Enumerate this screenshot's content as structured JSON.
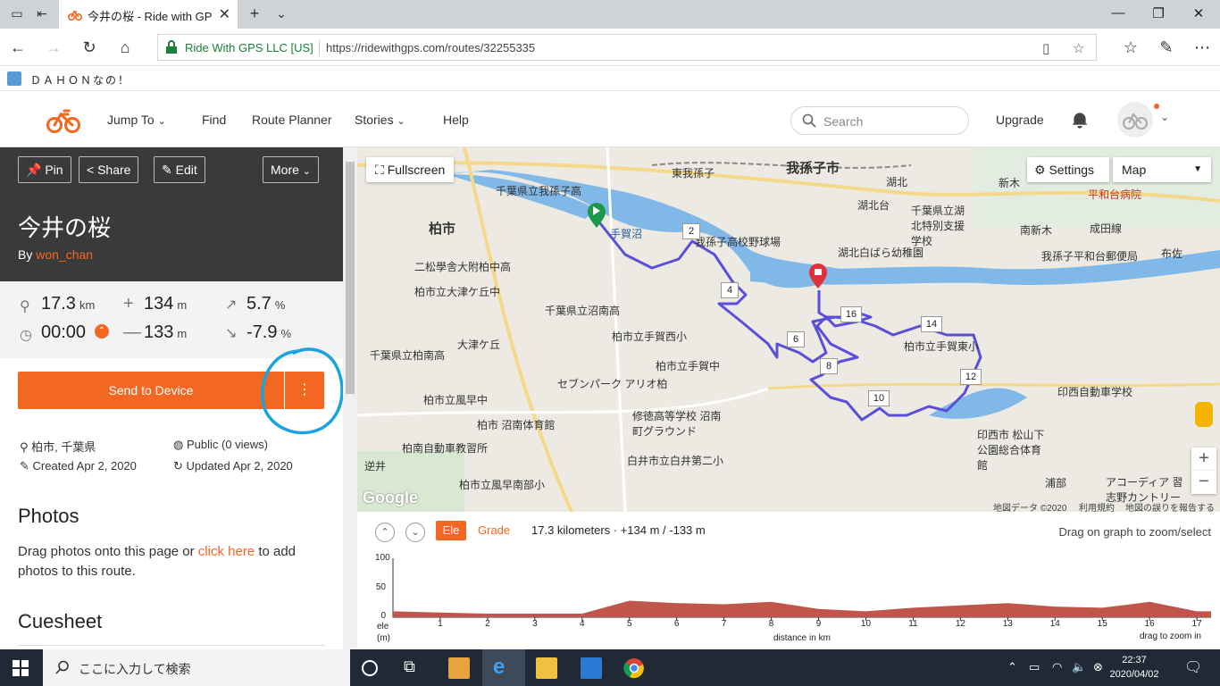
{
  "browser": {
    "tab_title": "今井の桜 - Ride with GPS",
    "cert": "Ride With GPS LLC [US]",
    "url": "https://ridewithgps.com/routes/32255335",
    "favorite": "ＤＡＨＯＮなの！"
  },
  "header": {
    "nav": [
      "Jump To",
      "Find",
      "Route Planner",
      "Stories",
      "Help"
    ],
    "search_placeholder": "Search",
    "upgrade": "Upgrade"
  },
  "route": {
    "buttons": {
      "pin": "Pin",
      "share": "Share",
      "edit": "Edit",
      "more": "More"
    },
    "title": "今井の桜",
    "by_label": "By",
    "owner": "won_chan",
    "stats": {
      "distance": "17.3",
      "distance_unit": "km",
      "gain": "134",
      "gain_unit": "m",
      "grade_up": "5.7",
      "grade_up_unit": "%",
      "time": "00:00",
      "loss": "133",
      "loss_unit": "m",
      "grade_down": "-7.9",
      "grade_down_unit": "%"
    },
    "send_button": "Send to Device",
    "location": "柏市, 千葉県",
    "privacy": "Public (0 views)",
    "created": "Created Apr 2, 2020",
    "updated": "Updated Apr 2, 2020",
    "photos_heading": "Photos",
    "photos_text_a": "Drag photos onto this page or ",
    "photos_link": "click here",
    "photos_text_b": " to add photos to this route.",
    "cuesheet_heading": "Cuesheet"
  },
  "map": {
    "fullscreen": "Fullscreen",
    "settings": "Settings",
    "map_type": "Map",
    "labels": {
      "abiko": "我孫子市",
      "kashiwa": "柏市",
      "tega": "手賀沼",
      "l1": "千葉県立我孫子高",
      "l2": "我孫子高校野球場",
      "l3": "湖北白ばら幼稚園",
      "l4": "千葉県立湖北特別支援学校",
      "l5": "我孫子平和台郵便局",
      "l6": "二松學舎大附柏中高",
      "l7": "柏市立大津ケ丘中",
      "l8": "千葉県立沼南高",
      "l9": "柏市立手賀西小",
      "l10": "千葉県立柏南高",
      "l11": "大津ケ丘",
      "l12": "柏市立手賀中",
      "l13": "セブンパーク アリオ柏",
      "l14": "柏市立風早中",
      "l15": "柏市 沼南体育館",
      "l16": "修徳高等学校 沼南町グラウンド",
      "l17": "柏南自動車教習所",
      "l18": "白井市立白井第二小",
      "l19": "柏市立風早南部小",
      "l20": "柏市立手賀東小",
      "l21": "印西自動車学校",
      "l22": "印西市 松山下 公園総合体育館",
      "l23": "平和台病院",
      "l24": "湖北台",
      "l25": "布佐",
      "l26": "新木",
      "l27": "南新木",
      "l28": "成田線",
      "l29": "浦部",
      "l30": "逆井",
      "l31": "湖北",
      "l32": "東我孫子",
      "l33": "アコーディア 習志野カントリー"
    },
    "markers": [
      "2",
      "4",
      "6",
      "8",
      "10",
      "12",
      "14",
      "16"
    ],
    "attrib_data": "地図データ ©2020",
    "attrib_terms": "利用規約",
    "attrib_report": "地図の誤りを報告する",
    "google": "Google"
  },
  "elevation": {
    "ele_tab": "Ele",
    "grade_tab": "Grade",
    "summary": "17.3 kilometers · +134 m / -133 m",
    "hint": "Drag on graph to zoom/select",
    "y_ticks": [
      "100",
      "50",
      "0"
    ],
    "y_label_a": "ele",
    "y_label_b": "(m)",
    "x_ticks": [
      "1",
      "2",
      "3",
      "4",
      "5",
      "6",
      "7",
      "8",
      "9",
      "10",
      "11",
      "12",
      "13",
      "14",
      "15",
      "16",
      "17"
    ],
    "x_label": "distance in km",
    "x_hint": "drag to zoom in",
    "ylim": [
      0,
      100
    ],
    "xlim": [
      0,
      17.3
    ],
    "profile": [
      [
        0,
        10
      ],
      [
        1,
        8
      ],
      [
        2,
        6
      ],
      [
        3,
        6
      ],
      [
        4,
        6
      ],
      [
        5,
        28
      ],
      [
        6,
        24
      ],
      [
        7,
        22
      ],
      [
        8,
        26
      ],
      [
        9,
        14
      ],
      [
        10,
        10
      ],
      [
        11,
        16
      ],
      [
        12,
        20
      ],
      [
        13,
        24
      ],
      [
        14,
        18
      ],
      [
        15,
        16
      ],
      [
        16,
        26
      ],
      [
        17,
        10
      ],
      [
        17.3,
        10
      ]
    ]
  },
  "taskbar": {
    "search": "ここに入力して検索",
    "time": "22:37",
    "date": "2020/04/02"
  },
  "colors": {
    "accent": "#f26722",
    "route": "#5a4fd8",
    "water": "#80b8e8"
  }
}
